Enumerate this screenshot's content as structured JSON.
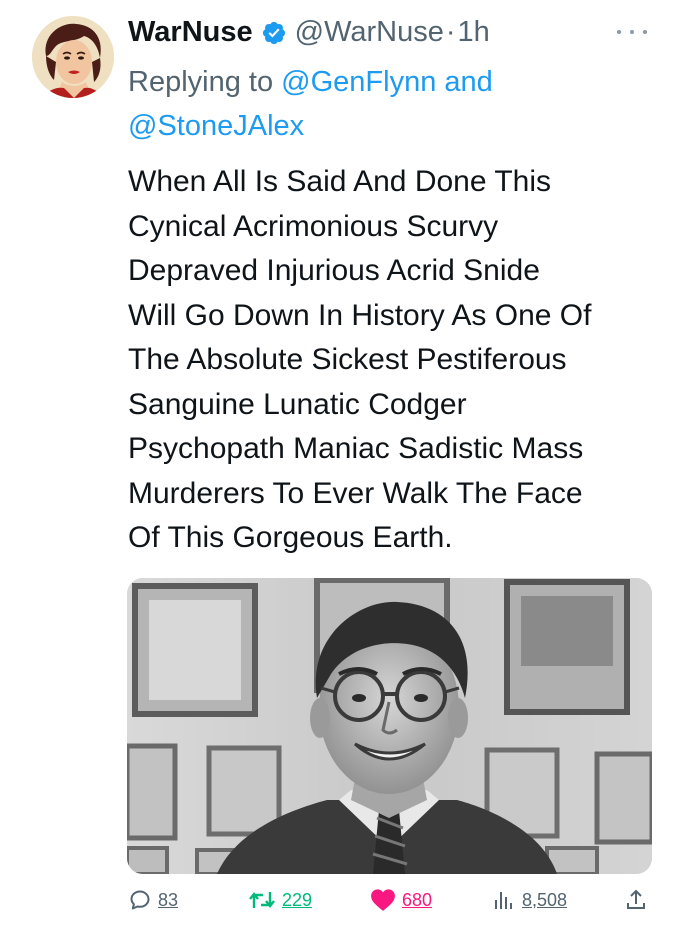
{
  "tweet": {
    "author": {
      "display_name": "WarNuse",
      "handle": "@WarNuse",
      "verified": true,
      "avatar_icon": "profile-avatar"
    },
    "time_separator": "·",
    "timestamp": "1h",
    "replying_prefix": "Replying to ",
    "replying_to": [
      "@GenFlynn",
      "@StoneJAlex"
    ],
    "replying_joiner": " and ",
    "text": "When All Is Said And Done This\nCynical Acrimonious Scurvy\nDepraved Injurious Acrid Snide\nWill Go Down In History As One Of\nThe Absolute Sickest Pestiferous\nSanguine Lunatic Codger\nPsychopath Maniac Sadistic Mass\nMurderers To Ever Walk The Face\nOf This Gorgeous Earth.",
    "media": {
      "type": "photo",
      "description_icon": "attached-photo"
    },
    "actions": {
      "replies": "83",
      "retweets": "229",
      "likes": "680",
      "views": "8,508"
    }
  },
  "colors": {
    "text": "#0f1419",
    "secondary": "#536471",
    "link": "#1d9bf0",
    "retweet": "#00ba7c",
    "like": "#f91880",
    "verified": "#1d9bf0"
  },
  "icons": {
    "more": "more-horizontal-icon",
    "reply": "reply-bubble-icon",
    "retweet": "retweet-arrows-icon",
    "like": "heart-icon",
    "views": "views-bars-icon",
    "share": "share-upload-icon",
    "verified": "verified-badge-icon"
  }
}
